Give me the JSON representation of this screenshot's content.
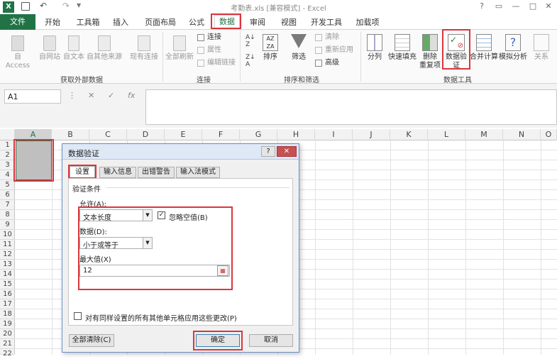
{
  "window": {
    "title": "考勤表.xls [兼容模式] - Excel"
  },
  "tabs": {
    "file": "文件",
    "items": [
      "开始",
      "工具箱",
      "插入",
      "页面布局",
      "公式",
      "数据",
      "审阅",
      "视图",
      "开发工具",
      "加载项"
    ],
    "active": "数据"
  },
  "ribbon": {
    "get_external": {
      "access": "自 Access",
      "web": "自网站",
      "text": "自文本",
      "other": "自其他来源",
      "existing": "现有连接",
      "group_label": "获取外部数据"
    },
    "connections": {
      "refresh_all": "全部刷新",
      "connections": "连接",
      "properties": "属性",
      "edit_links": "编辑链接",
      "group_label": "连接"
    },
    "sort_filter": {
      "sort": "排序",
      "filter": "筛选",
      "clear": "清除",
      "reapply": "重新应用",
      "advanced": "高级",
      "group_label": "排序和筛选"
    },
    "data_tools": {
      "split": "分列",
      "flash_fill": "快速填充",
      "remove_dup_1": "删除",
      "remove_dup_2": "重复项",
      "validation_1": "数据验",
      "validation_2": "证",
      "consolidate": "合并计算",
      "what_if": "模拟分析",
      "relations": "关系",
      "group_label": "数据工具"
    }
  },
  "formula_bar": {
    "name_box": "A1",
    "fx": "fx",
    "cancel": "✕",
    "enter": "✓",
    "more": "⋮"
  },
  "grid": {
    "columns": [
      "A",
      "B",
      "C",
      "D",
      "E",
      "F",
      "G",
      "H",
      "I",
      "J",
      "K",
      "L",
      "M",
      "N",
      "O"
    ],
    "rows": [
      "1",
      "2",
      "3",
      "4",
      "5",
      "6",
      "7",
      "8",
      "9",
      "10",
      "11",
      "12",
      "13",
      "14",
      "15",
      "16",
      "17",
      "18",
      "19",
      "20",
      "21",
      "22"
    ]
  },
  "dialog": {
    "title": "数据验证",
    "help": "?",
    "close": "✕",
    "tabs": [
      "设置",
      "输入信息",
      "出错警告",
      "输入法模式"
    ],
    "section": "验证条件",
    "allow_label": "允许(A):",
    "allow_value": "文本长度",
    "ignore_blank": "忽略空值(B)",
    "data_label": "数据(D):",
    "data_value": "小于或等于",
    "max_label": "最大值(X)",
    "max_value": "12",
    "apply_all": "对有同样设置的所有其他单元格应用这些更改(P)",
    "clear_all": "全部清除(C)",
    "ok": "确定",
    "cancel": "取消"
  },
  "colors": {
    "excel_green": "#217346",
    "highlight_red": "#d9363e",
    "selection_gray": "#bfbfbf"
  }
}
